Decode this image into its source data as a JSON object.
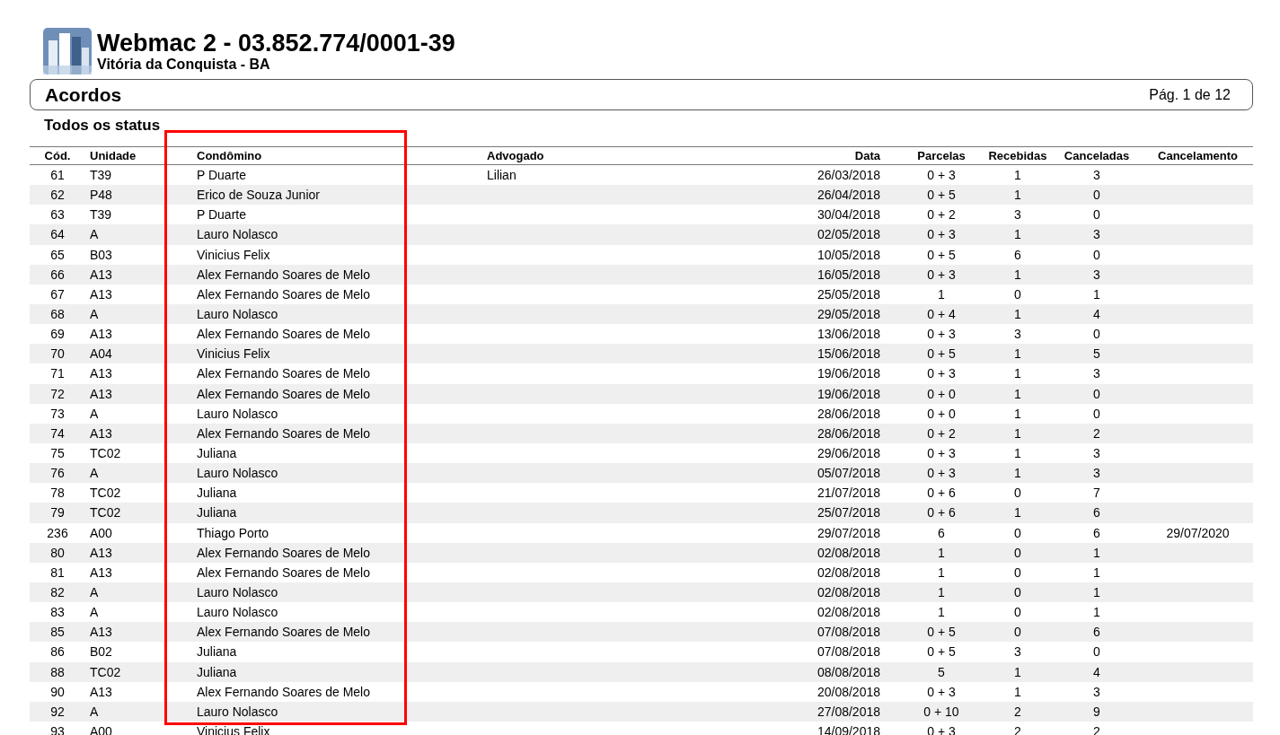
{
  "header": {
    "title": "Webmac 2 - 03.852.774/0001-39",
    "subtitle": "Vitória da Conquista - BA"
  },
  "report": {
    "title": "Acordos",
    "page": "Pág. 1 de 12"
  },
  "filter": "Todos os status",
  "highlight": {
    "color": "#ff0000"
  },
  "table": {
    "columns": [
      {
        "label": "Cód.",
        "highlighted": false
      },
      {
        "label": "Unidade",
        "highlighted": false
      },
      {
        "label": "Condômino",
        "highlighted": true
      },
      {
        "label": "Advogado",
        "highlighted": false
      },
      {
        "label": "Data",
        "highlighted": false
      },
      {
        "label": "Parcelas",
        "highlighted": false
      },
      {
        "label": "Recebidas",
        "highlighted": false
      },
      {
        "label": "Canceladas",
        "highlighted": false
      },
      {
        "label": "Cancelamento",
        "highlighted": false
      }
    ],
    "rows": [
      {
        "cod": "61",
        "unidade": "T39",
        "condomino": "P Duarte",
        "advogado": "Lilian",
        "data": "26/03/2018",
        "parcelas": "0 + 3",
        "recebidas": "1",
        "canceladas": "3"
      },
      {
        "cod": "62",
        "unidade": "P48",
        "condomino": "Erico de Souza Junior",
        "data": "26/04/2018",
        "parcelas": "0 + 5",
        "recebidas": "1",
        "canceladas": "0"
      },
      {
        "cod": "63",
        "unidade": "T39",
        "condomino": "P Duarte",
        "data": "30/04/2018",
        "parcelas": "0 + 2",
        "recebidas": "3",
        "canceladas": "0"
      },
      {
        "cod": "64",
        "unidade": "A",
        "condomino": "Lauro Nolasco",
        "data": "02/05/2018",
        "parcelas": "0 + 3",
        "recebidas": "1",
        "canceladas": "3"
      },
      {
        "cod": "65",
        "unidade": "B03",
        "condomino": "Vinicius Felix",
        "data": "10/05/2018",
        "parcelas": "0 + 5",
        "recebidas": "6",
        "canceladas": "0"
      },
      {
        "cod": "66",
        "unidade": "A13",
        "condomino": "Alex Fernando Soares de Melo",
        "data": "16/05/2018",
        "parcelas": "0 + 3",
        "recebidas": "1",
        "canceladas": "3"
      },
      {
        "cod": "67",
        "unidade": "A13",
        "condomino": "Alex Fernando Soares de Melo",
        "data": "25/05/2018",
        "parcelas": "1",
        "recebidas": "0",
        "canceladas": "1"
      },
      {
        "cod": "68",
        "unidade": "A",
        "condomino": "Lauro Nolasco",
        "data": "29/05/2018",
        "parcelas": "0 + 4",
        "recebidas": "1",
        "canceladas": "4"
      },
      {
        "cod": "69",
        "unidade": "A13",
        "condomino": "Alex Fernando Soares de Melo",
        "data": "13/06/2018",
        "parcelas": "0 + 3",
        "recebidas": "3",
        "canceladas": "0"
      },
      {
        "cod": "70",
        "unidade": "A04",
        "condomino": "Vinicius Felix",
        "data": "15/06/2018",
        "parcelas": "0 + 5",
        "recebidas": "1",
        "canceladas": "5"
      },
      {
        "cod": "71",
        "unidade": "A13",
        "condomino": "Alex Fernando Soares de Melo",
        "data": "19/06/2018",
        "parcelas": "0 + 3",
        "recebidas": "1",
        "canceladas": "3"
      },
      {
        "cod": "72",
        "unidade": "A13",
        "condomino": "Alex Fernando Soares de Melo",
        "data": "19/06/2018",
        "parcelas": "0 + 0",
        "recebidas": "1",
        "canceladas": "0"
      },
      {
        "cod": "73",
        "unidade": "A",
        "condomino": "Lauro Nolasco",
        "data": "28/06/2018",
        "parcelas": "0 + 0",
        "recebidas": "1",
        "canceladas": "0"
      },
      {
        "cod": "74",
        "unidade": "A13",
        "condomino": "Alex Fernando Soares de Melo",
        "data": "28/06/2018",
        "parcelas": "0 + 2",
        "recebidas": "1",
        "canceladas": "2"
      },
      {
        "cod": "75",
        "unidade": "TC02",
        "condomino": "Juliana",
        "data": "29/06/2018",
        "parcelas": "0 + 3",
        "recebidas": "1",
        "canceladas": "3"
      },
      {
        "cod": "76",
        "unidade": "A",
        "condomino": "Lauro Nolasco",
        "data": "05/07/2018",
        "parcelas": "0 + 3",
        "recebidas": "1",
        "canceladas": "3"
      },
      {
        "cod": "78",
        "unidade": "TC02",
        "condomino": "Juliana",
        "data": "21/07/2018",
        "parcelas": "0 + 6",
        "recebidas": "0",
        "canceladas": "7"
      },
      {
        "cod": "79",
        "unidade": "TC02",
        "condomino": "Juliana",
        "data": "25/07/2018",
        "parcelas": "0 + 6",
        "recebidas": "1",
        "canceladas": "6"
      },
      {
        "cod": "236",
        "unidade": "A00",
        "condomino": "Thiago Porto",
        "data": "29/07/2018",
        "parcelas": "6",
        "recebidas": "0",
        "canceladas": "6",
        "cancelamento": "29/07/2020"
      },
      {
        "cod": "80",
        "unidade": "A13",
        "condomino": "Alex Fernando Soares de Melo",
        "data": "02/08/2018",
        "parcelas": "1",
        "recebidas": "0",
        "canceladas": "1"
      },
      {
        "cod": "81",
        "unidade": "A13",
        "condomino": "Alex Fernando Soares de Melo",
        "data": "02/08/2018",
        "parcelas": "1",
        "recebidas": "0",
        "canceladas": "1"
      },
      {
        "cod": "82",
        "unidade": "A",
        "condomino": "Lauro Nolasco",
        "data": "02/08/2018",
        "parcelas": "1",
        "recebidas": "0",
        "canceladas": "1"
      },
      {
        "cod": "83",
        "unidade": "A",
        "condomino": "Lauro Nolasco",
        "data": "02/08/2018",
        "parcelas": "1",
        "recebidas": "0",
        "canceladas": "1"
      },
      {
        "cod": "85",
        "unidade": "A13",
        "condomino": "Alex Fernando Soares de Melo",
        "data": "07/08/2018",
        "parcelas": "0 + 5",
        "recebidas": "0",
        "canceladas": "6"
      },
      {
        "cod": "86",
        "unidade": "B02",
        "condomino": "Juliana",
        "data": "07/08/2018",
        "parcelas": "0 + 5",
        "recebidas": "3",
        "canceladas": "0"
      },
      {
        "cod": "88",
        "unidade": "TC02",
        "condomino": "Juliana",
        "data": "08/08/2018",
        "parcelas": "5",
        "recebidas": "1",
        "canceladas": "4"
      },
      {
        "cod": "90",
        "unidade": "A13",
        "condomino": "Alex Fernando Soares de Melo",
        "data": "20/08/2018",
        "parcelas": "0 + 3",
        "recebidas": "1",
        "canceladas": "3"
      },
      {
        "cod": "92",
        "unidade": "A",
        "condomino": "Lauro Nolasco",
        "data": "27/08/2018",
        "parcelas": "0 + 10",
        "recebidas": "2",
        "canceladas": "9"
      },
      {
        "cod": "93",
        "unidade": "A00",
        "condomino": "Vinicius Felix",
        "data": "14/09/2018",
        "parcelas": "0 + 3",
        "recebidas": "2",
        "canceladas": "2"
      }
    ]
  }
}
